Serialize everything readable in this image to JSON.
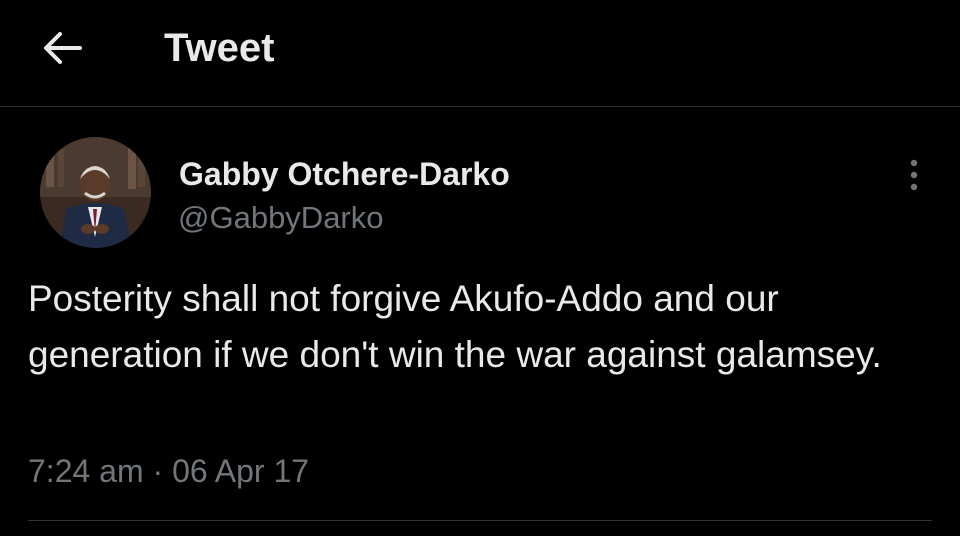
{
  "header": {
    "title": "Tweet",
    "back_icon": "arrow-left-icon"
  },
  "tweet": {
    "author": {
      "name": "Gabby Otchere-Darko",
      "handle": "@GabbyDarko",
      "avatar": "avatar-photo"
    },
    "more_icon": "more-vertical-icon",
    "text": "Posterity shall not forgive Akufo-Addo and our generation if we don't win the war against galamsey.",
    "time": "7:24 am",
    "separator": "·",
    "date": "06 Apr 17"
  },
  "colors": {
    "background": "#000000",
    "primary_text": "#e7e9ea",
    "secondary_text": "#71767b",
    "divider": "#2f3336"
  }
}
